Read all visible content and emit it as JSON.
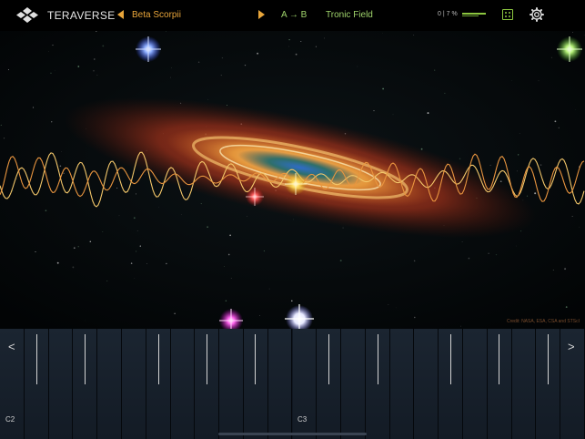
{
  "header": {
    "app_name": "TERAVERSE",
    "star_name": "Beta Scorpii",
    "route": "A → B",
    "field": "Tronic Field",
    "percent": "0 | 7 %"
  },
  "space": {
    "credit": "Credit: NASA, ESA, CSA and STScI"
  },
  "keyboard": {
    "left_arrow": "<",
    "right_arrow": ">",
    "label_c2": "C2",
    "label_c3": "C3"
  },
  "colors": {
    "accent_orange": "#e8a53a",
    "accent_green": "#8cc63f",
    "wave_yellow": "#f3c76a",
    "wave_orange": "#e9953f"
  }
}
